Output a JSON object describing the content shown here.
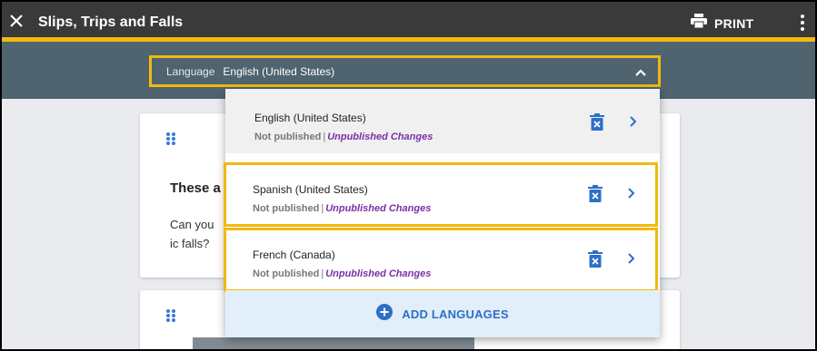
{
  "header": {
    "title": "Slips, Trips and Falls",
    "print_label": "PRINT",
    "icons": {
      "close": "close-icon",
      "print": "printer-icon",
      "more": "more-vertical-icon"
    },
    "colors": {
      "bar": "#3a3a3a",
      "accent": "#f2b90f"
    }
  },
  "language_bar": {
    "label": "Language",
    "selected": "English (United States)",
    "icon": "chevron-up-icon"
  },
  "dropdown": {
    "options": [
      {
        "name": "English (United States)",
        "status": "Not published",
        "changes": "Unpublished Changes"
      },
      {
        "name": "Spanish (United States)",
        "status": "Not published",
        "changes": "Unpublished Changes"
      },
      {
        "name": "French (Canada)",
        "status": "Not published",
        "changes": "Unpublished Changes"
      }
    ],
    "separator": "|",
    "add_label": "ADD LANGUAGES",
    "colors": {
      "link": "#2d6fc7",
      "changes": "#7b2fa5"
    }
  },
  "cards": {
    "card1": {
      "heading": "These a",
      "text": "Can you ic falls?"
    }
  }
}
